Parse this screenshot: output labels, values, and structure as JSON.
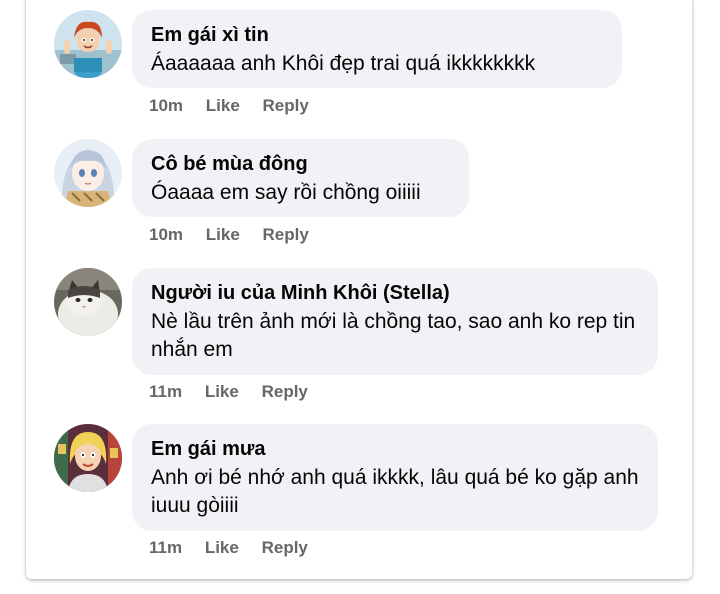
{
  "comments": [
    {
      "author": "Em gái xì tin",
      "text": "Áaaaaaa anh Khôi đẹp trai quá ikkkkkkkk",
      "time": "10m",
      "like_label": "Like",
      "reply_label": "Reply"
    },
    {
      "author": "Cô bé mùa đông",
      "text": "Óaaaa em say rồi chồng oiiiii",
      "time": "10m",
      "like_label": "Like",
      "reply_label": "Reply"
    },
    {
      "author": "Người iu của Minh Khôi (Stella)",
      "text": "Nè lầu trên ảnh mới là chồng tao, sao anh ko rep tin nhắn em",
      "time": "11m",
      "like_label": "Like",
      "reply_label": "Reply"
    },
    {
      "author": "Em gái mưa",
      "text": "Anh ơi bé nhớ anh quá ikkkk, lâu quá bé ko gặp anh iuuu gòiiii",
      "time": "11m",
      "like_label": "Like",
      "reply_label": "Reply"
    }
  ],
  "colors": {
    "bubble": "#f0f2f5",
    "meta_text": "#65676b",
    "name_text": "#050505"
  },
  "avatars": [
    "cartoon-woman-avatar",
    "anime-girl-avatar",
    "cat-photo-avatar",
    "cartoon-blonde-avatar"
  ]
}
